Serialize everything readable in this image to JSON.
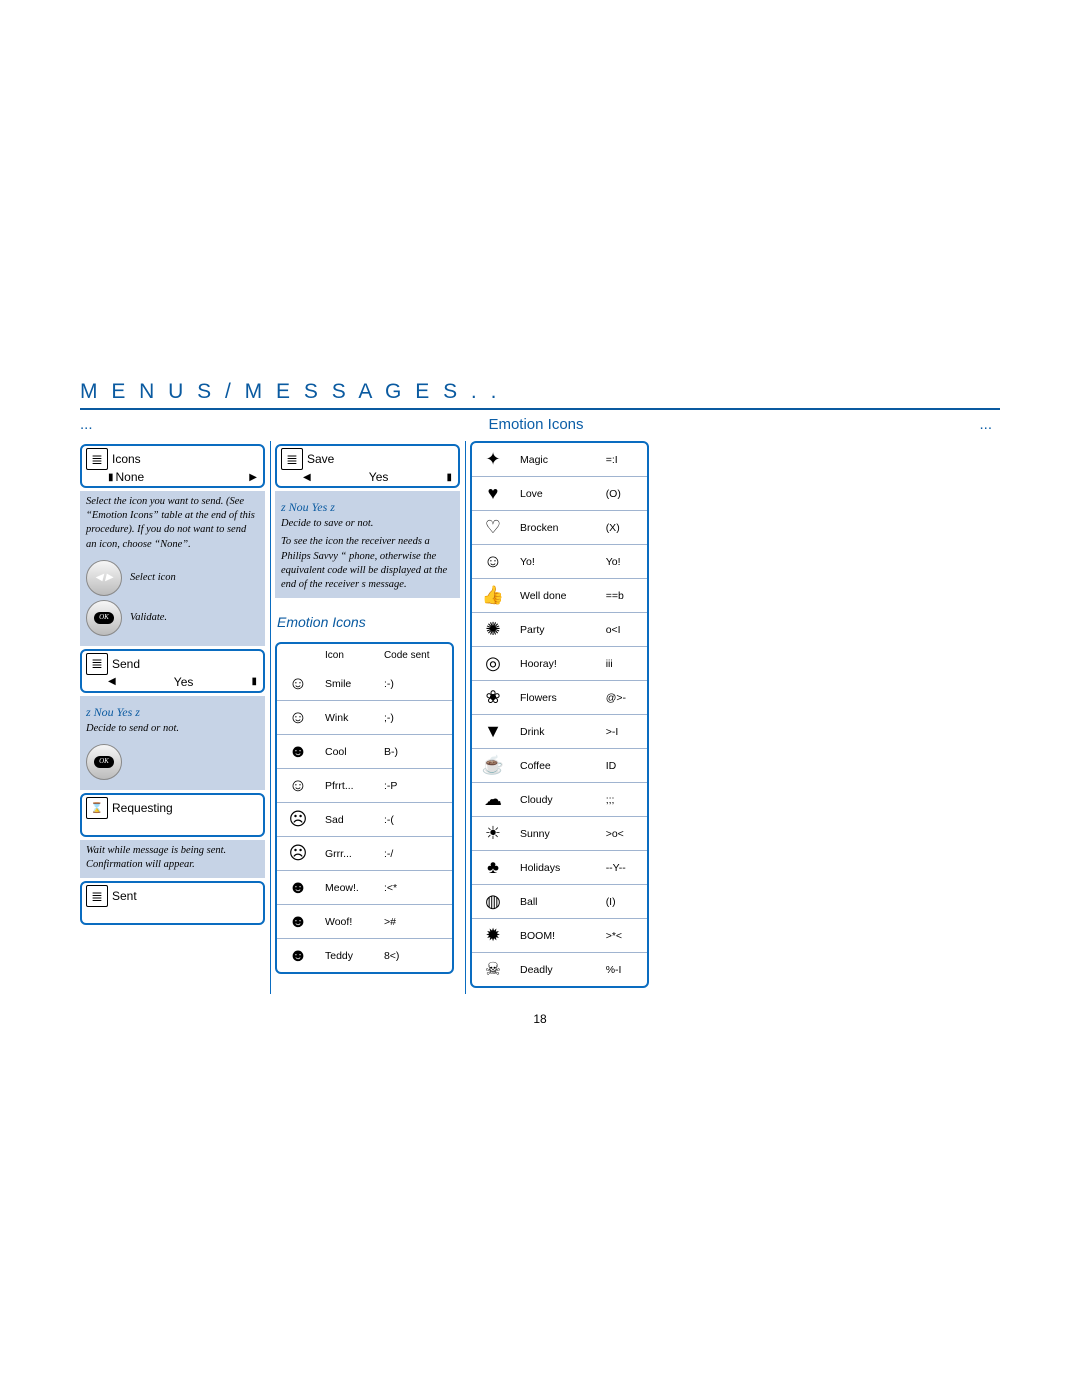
{
  "header": "M E N U S   /   M E S S A G E S . .",
  "subhead": {
    "left": "...",
    "center": "Emotion Icons",
    "right": "..."
  },
  "col1": {
    "screen_icons": {
      "title": "Icons",
      "value": "None"
    },
    "instr1": "Select the icon you want to send. (See “Emotion Icons” table at the end of this procedure). If you do not want to send an icon, choose “None”.",
    "btn_select": "Select icon",
    "btn_validate": "Validate.",
    "screen_send": {
      "title": "Send",
      "value": "Yes"
    },
    "nou": "z Nou Yes z",
    "instr2": "Decide to send or not.",
    "screen_req": "Requesting",
    "instr3": "Wait while message is being sent. Confirmation will appear.",
    "screen_sent": "Sent"
  },
  "col2": {
    "screen_save": {
      "title": "Save",
      "value": "Yes"
    },
    "nou": "z Nou Yes z",
    "instr1": "Decide to save or not.",
    "instr2": "To see the icon the receiver needs a Philips Savvy “ phone, otherwise the equivalent code will be displayed at the end of the receiver s message.",
    "table_title": "Emotion Icons",
    "headers": {
      "icon": "Icon",
      "code": "Code sent"
    },
    "rows": [
      {
        "glyph": "☺",
        "name": "Smile",
        "code": ":-)"
      },
      {
        "glyph": "☺",
        "name": "Wink",
        "code": ";-)"
      },
      {
        "glyph": "☻",
        "name": "Cool",
        "code": "B-)"
      },
      {
        "glyph": "☺",
        "name": "Pfrrt...",
        "code": ":-P"
      },
      {
        "glyph": "☹",
        "name": "Sad",
        "code": ":-("
      },
      {
        "glyph": "☹",
        "name": "Grrr...",
        "code": ":-/"
      },
      {
        "glyph": "☻",
        "name": "Meow!.",
        "code": ":<*"
      },
      {
        "glyph": "☻",
        "name": "Woof!",
        "code": ">#"
      },
      {
        "glyph": "☻",
        "name": "Teddy",
        "code": "8<)"
      }
    ]
  },
  "col3": {
    "rows": [
      {
        "glyph": "✦",
        "name": "Magic",
        "code": "=:I"
      },
      {
        "glyph": "♥",
        "name": "Love",
        "code": "(O)"
      },
      {
        "glyph": "♡",
        "name": "Brocken",
        "code": "(X)"
      },
      {
        "glyph": "☺",
        "name": "Yo!",
        "code": "Yo!"
      },
      {
        "glyph": "👍",
        "name": "Well done",
        "code": "==b"
      },
      {
        "glyph": "✺",
        "name": "Party",
        "code": "o<I"
      },
      {
        "glyph": "◎",
        "name": "Hooray!",
        "code": "iii"
      },
      {
        "glyph": "❀",
        "name": "Flowers",
        "code": "@>-"
      },
      {
        "glyph": "▼",
        "name": "Drink",
        "code": ">-I"
      },
      {
        "glyph": "☕",
        "name": "Coffee",
        "code": "ID"
      },
      {
        "glyph": "☁",
        "name": "Cloudy",
        "code": ";;;"
      },
      {
        "glyph": "☀",
        "name": "Sunny",
        "code": ">o<"
      },
      {
        "glyph": "♣",
        "name": "Holidays",
        "code": "--Y--"
      },
      {
        "glyph": "◍",
        "name": "Ball",
        "code": "(I)"
      },
      {
        "glyph": "✹",
        "name": "BOOM!",
        "code": ">*<"
      },
      {
        "glyph": "☠",
        "name": "Deadly",
        "code": "%-I"
      }
    ]
  },
  "page_number": "18"
}
